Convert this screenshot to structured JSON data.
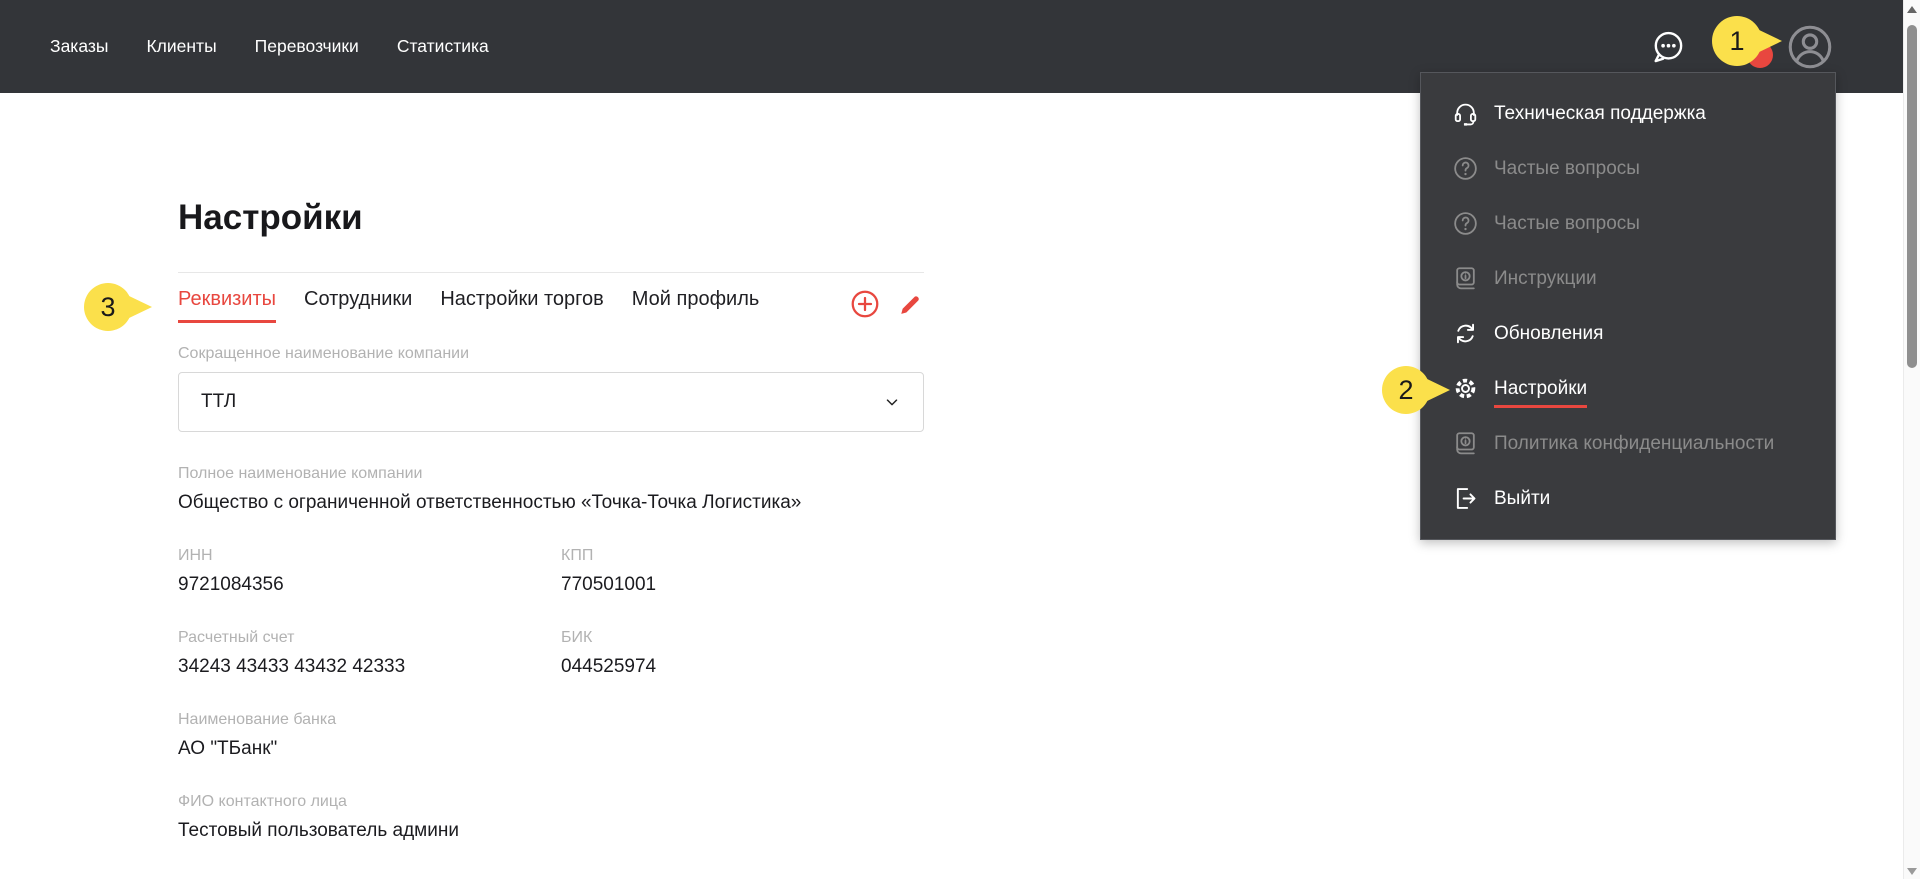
{
  "colors": {
    "header_bg": "#333539",
    "menu_bg": "#3a3b3e",
    "accent_red": "#e8473f",
    "balloon_yellow": "#fbe04b",
    "label_gray": "#b2b2b2"
  },
  "header": {
    "nav": [
      {
        "label": "Заказы"
      },
      {
        "label": "Клиенты"
      },
      {
        "label": "Перевозчики"
      },
      {
        "label": "Статистика"
      }
    ],
    "icons": [
      {
        "name": "chat-icon"
      },
      {
        "name": "user-icon"
      }
    ]
  },
  "user_menu": {
    "items": [
      {
        "label": "Техническая поддержка",
        "icon": "headset-icon",
        "disabled": false
      },
      {
        "label": "Частые вопросы",
        "icon": "question-icon",
        "disabled": true
      },
      {
        "label": "Частые вопросы",
        "icon": "question-icon",
        "disabled": true
      },
      {
        "label": "Инструкции",
        "icon": "book-info-icon",
        "disabled": true
      },
      {
        "label": "Обновления",
        "icon": "refresh-icon",
        "disabled": false
      },
      {
        "label": "Настройки",
        "icon": "gear-icon",
        "disabled": false,
        "underlined": true
      },
      {
        "label": "Политика конфиденциальности",
        "icon": "book-info-icon",
        "disabled": true
      },
      {
        "label": "Выйти",
        "icon": "logout-icon",
        "disabled": false
      }
    ]
  },
  "page": {
    "title": "Настройки",
    "tabs": [
      {
        "label": "Реквизиты",
        "active": true
      },
      {
        "label": "Сотрудники",
        "active": false
      },
      {
        "label": "Настройки торгов",
        "active": false
      },
      {
        "label": "Мой профиль",
        "active": false
      }
    ],
    "actions": [
      {
        "name": "add-circle-icon"
      },
      {
        "name": "edit-pencil-icon"
      }
    ],
    "fields": {
      "short_name": {
        "label": "Сокращенное наименование компании",
        "value": "ТТЛ"
      },
      "full_name": {
        "label": "Полное наименование компании",
        "value": "Общество с ограниченной ответственностью «Точка-Точка Логистика»"
      },
      "inn": {
        "label": "ИНН",
        "value": "9721084356"
      },
      "kpp": {
        "label": "КПП",
        "value": "770501001"
      },
      "account": {
        "label": "Расчетный счет",
        "value": "34243 43433 43432 42333"
      },
      "bik": {
        "label": "БИК",
        "value": "044525974"
      },
      "bank": {
        "label": "Наименование банка",
        "value": "АО \"ТБанк\""
      },
      "contact": {
        "label": "ФИО контактного лица",
        "value": "Тестовый пользователь админи"
      }
    }
  },
  "annotations": {
    "step1": "1",
    "step2": "2",
    "step3": "3"
  }
}
